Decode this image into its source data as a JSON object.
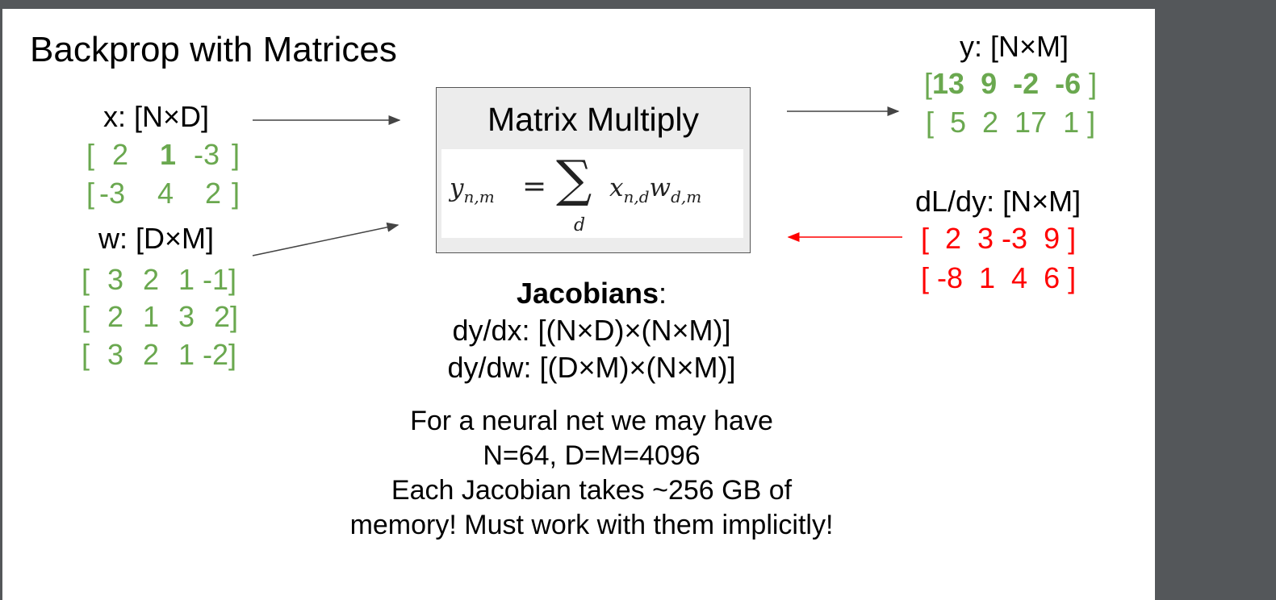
{
  "slide": {
    "title": "Backprop with Matrices",
    "x": {
      "label": "x: [N×D]",
      "rows": [
        [
          "[",
          "2",
          "1",
          "-3",
          "]"
        ],
        [
          "[",
          "-3",
          "4",
          "2",
          "]"
        ]
      ]
    },
    "w": {
      "label": "w: [D×M]",
      "rows": [
        [
          "[",
          "3",
          "2",
          "1",
          "-1]"
        ],
        [
          "[",
          "2",
          "1",
          "3",
          "2]"
        ],
        [
          "[",
          "3",
          "2",
          "1",
          "-2]"
        ]
      ]
    },
    "box": {
      "title": "Matrix Multiply",
      "formula": {
        "lhs_var": "y",
        "lhs_sub": "n,m",
        "eq": "=",
        "sum": "∑",
        "sum_index": "d",
        "x_var": "x",
        "x_sub": "n,d",
        "w_var": "w",
        "w_sub": "d,m"
      }
    },
    "y": {
      "label": "y: [N×M]",
      "row1": {
        "open": "[",
        "vals": "13  9  -2  -6",
        "close": "]"
      },
      "row2": "[  5  2  17  1 ]"
    },
    "dLdy": {
      "label": "dL/dy: [N×M]",
      "rows": [
        "[  2  3 -3  9 ]",
        "[ -8  1  4  6 ]"
      ]
    },
    "jacobians": {
      "heading": "Jacobians",
      "colon": ":",
      "dydx": "dy/dx: [(N×D)×(N×M)]",
      "dydw": "dy/dw: [(D×M)×(N×M)]"
    },
    "note": [
      "For a neural net we may have",
      "N=64, D=M=4096",
      "Each Jacobian takes ~256 GB of",
      "memory! Must work with them implicitly!"
    ],
    "colors": {
      "matrix_green": "#6aa84f",
      "gradient_red": "#ff0000",
      "background": "#54575a"
    }
  }
}
